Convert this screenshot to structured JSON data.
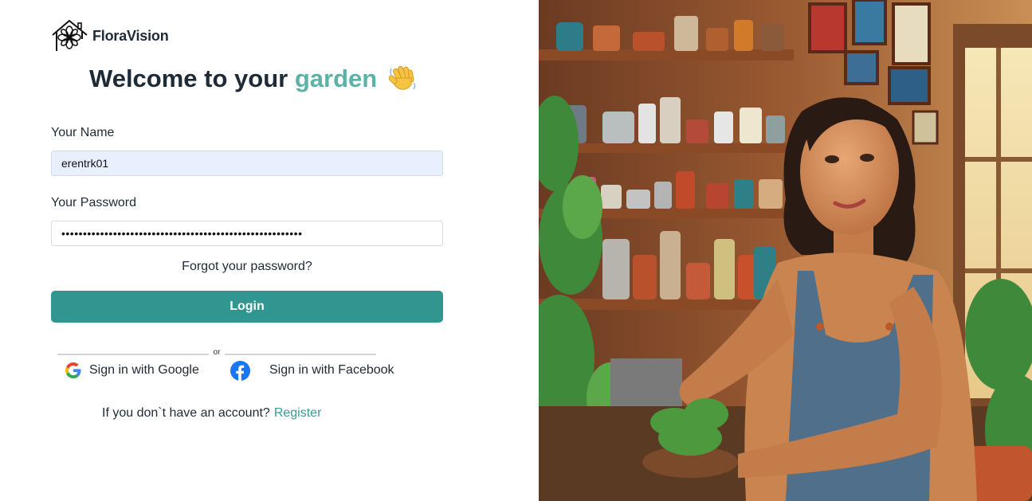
{
  "brand": {
    "name": "FloraVision"
  },
  "heading": {
    "prefix": "Welcome to your",
    "accent": "garden",
    "emoji": "👋"
  },
  "form": {
    "name_label": "Your Name",
    "name_value": "erentrk01",
    "password_label": "Your Password",
    "password_value": "••••••••••••••••••••••••••••••••••••••••••••••••••••••••",
    "forgot_label": "Forgot your password?",
    "login_label": "Login"
  },
  "divider": {
    "text": "or"
  },
  "social": {
    "google_label": "Sign in with Google",
    "facebook_label": "Sign in with Facebook"
  },
  "account": {
    "prompt": "If you don`t have an account?",
    "register_label": "Register"
  },
  "hero": {
    "image": "illustration-woman-with-plants-in-shop"
  },
  "colors": {
    "accent": "#5bb2a5",
    "button": "#31968f",
    "link": "#3a9a93",
    "name_field_bg": "#e8f0fe"
  }
}
